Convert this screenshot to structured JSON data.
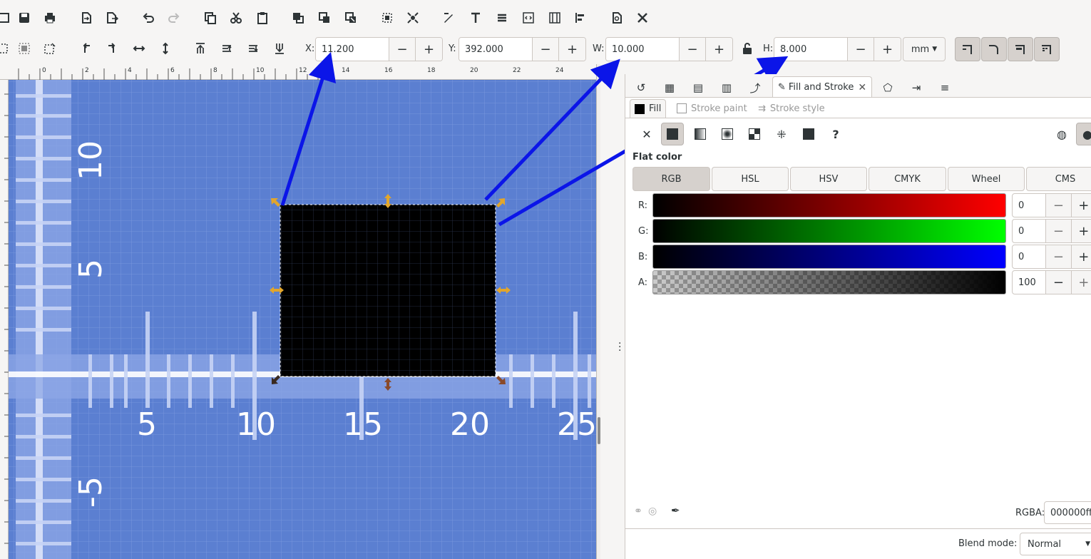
{
  "toolbar": {
    "x_label": "X:",
    "x_value": "11.200",
    "y_label": "Y:",
    "y_value": "392.000",
    "w_label": "W:",
    "w_value": "10.000",
    "h_label": "H:",
    "h_value": "8.000",
    "minus": "−",
    "plus": "+",
    "unit": "mm"
  },
  "ruler": {
    "top_ticks": [
      "0",
      "2",
      "4",
      "6",
      "8",
      "10",
      "12",
      "14",
      "16",
      "18",
      "20",
      "22",
      "24"
    ]
  },
  "canvas": {
    "x_numbers": [
      "5",
      "10",
      "15",
      "20",
      "25"
    ],
    "y_numbers": [
      "10",
      "5",
      "-5"
    ],
    "background_color": "#5b7fd1",
    "rect_color": "#000000"
  },
  "panel": {
    "active_tab": "Fill and Stroke",
    "subtabs": {
      "fill": "Fill",
      "stroke_paint": "Stroke paint",
      "stroke_style": "Stroke style"
    },
    "flat_color": "Flat color",
    "color_modes": [
      "RGB",
      "HSL",
      "HSV",
      "CMYK",
      "Wheel",
      "CMS"
    ],
    "active_mode": "RGB",
    "channels": [
      {
        "label": "R:",
        "value": "0"
      },
      {
        "label": "G:",
        "value": "0"
      },
      {
        "label": "B:",
        "value": "0"
      },
      {
        "label": "A:",
        "value": "100"
      }
    ],
    "unknown_mode": "?",
    "rgba_label": "RGBA:",
    "rgba_value": "000000ff",
    "blend_label": "Blend mode:",
    "blend_value": "Normal"
  },
  "annotation_color": "#0b15e8"
}
